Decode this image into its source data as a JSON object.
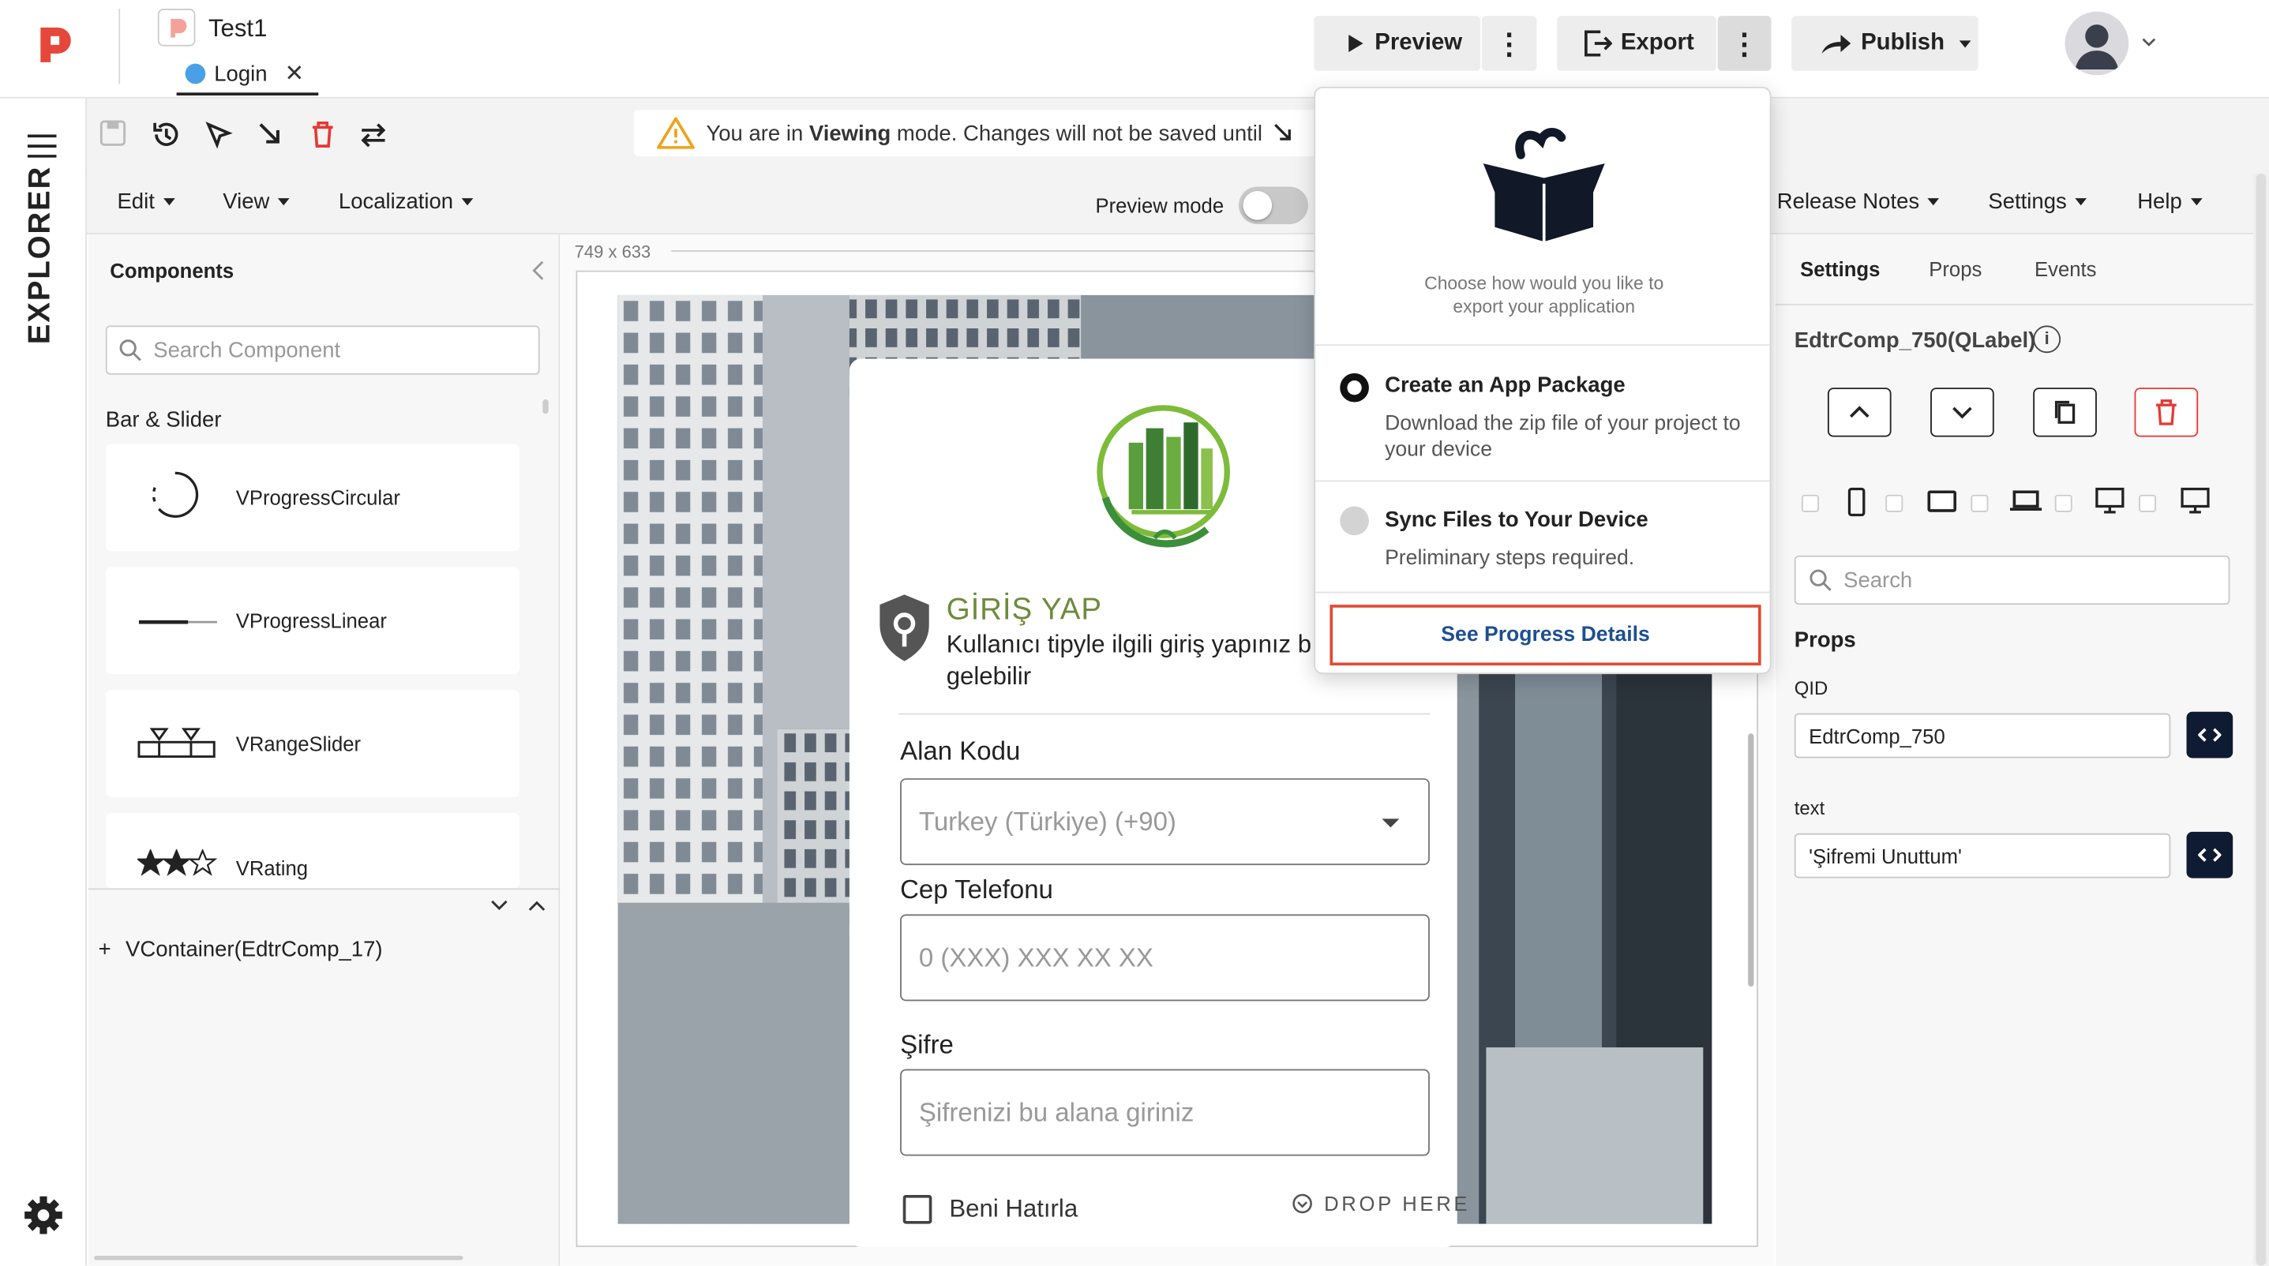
{
  "topbar": {
    "project_name": "Test1",
    "page_tab": "Login",
    "preview_label": "Preview",
    "export_label": "Export",
    "publish_label": "Publish"
  },
  "rail": {
    "title": "EXPLORER"
  },
  "toolbar": {
    "notice_prefix": "You are in ",
    "notice_mode": "Viewing",
    "notice_suffix": " mode. Changes will not be saved until"
  },
  "menubar": {
    "items": [
      "Edit",
      "View",
      "Localization"
    ],
    "preview_mode_label": "Preview mode",
    "right_items": [
      "Release Notes",
      "Settings",
      "Help"
    ]
  },
  "left_panel": {
    "title": "Components",
    "search_placeholder": "Search Component",
    "section": "Bar & Slider",
    "components": [
      "VProgressCircular",
      "VProgressLinear",
      "VRangeSlider",
      "VRating"
    ],
    "tree_item": "VContainer(EdtrComp_17)"
  },
  "canvas": {
    "size_label": "749 x 633",
    "form": {
      "title": "GİRİŞ YAP",
      "subtitle_line1": "Kullanıcı tipyle ilgili giriş yapınız b",
      "subtitle_line2": "gelebilir",
      "area_code_label": "Alan Kodu",
      "area_code_value": "Turkey (Türkiye) (+90)",
      "phone_label": "Cep Telefonu",
      "phone_placeholder": "0 (XXX) XXX XX XX",
      "password_label": "Şifre",
      "password_placeholder": "Şifrenizi bu alana giriniz",
      "remember_label": "Beni Hatırla",
      "drop_here": "DROP HERE"
    }
  },
  "right_panel": {
    "tabs": [
      "Settings",
      "Props",
      "Events"
    ],
    "component_title": "EdtrComp_750(QLabel)",
    "search_placeholder": "Search",
    "props_heading": "Props",
    "qid_label": "QID",
    "qid_value": "EdtrComp_750",
    "text_label": "text",
    "text_value": "'Şifremi Unuttum'"
  },
  "export_popup": {
    "description": "Choose how would you like to export your application",
    "option1_title": "Create an App Package",
    "option1_desc": "Download the zip file of your project to your device",
    "option2_title": "Sync Files to Your Device",
    "option2_desc": "Preliminary steps required.",
    "progress_link": "See Progress Details"
  },
  "colors": {
    "brand": "#e5483a",
    "dark": "#0f1b33",
    "highlight_border": "#e04b33",
    "link": "#1d4f91"
  }
}
